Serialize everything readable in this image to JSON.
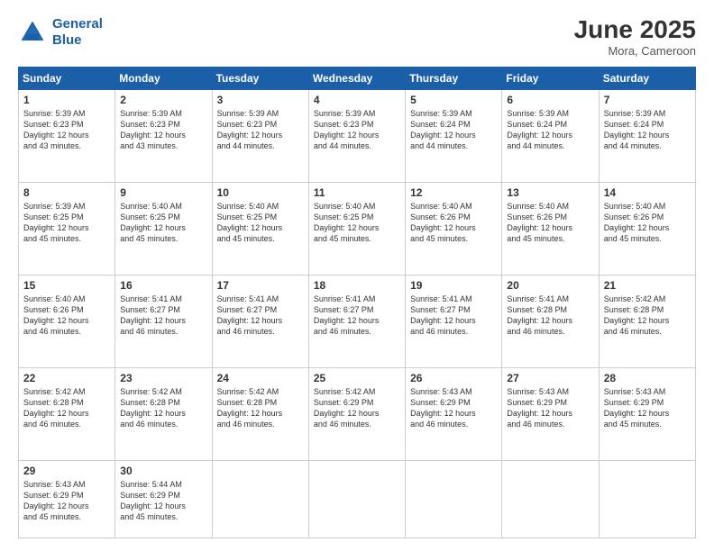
{
  "logo": {
    "line1": "General",
    "line2": "Blue"
  },
  "title": "June 2025",
  "location": "Mora, Cameroon",
  "headers": [
    "Sunday",
    "Monday",
    "Tuesday",
    "Wednesday",
    "Thursday",
    "Friday",
    "Saturday"
  ],
  "weeks": [
    [
      {
        "day": "1",
        "text": "Sunrise: 5:39 AM\nSunset: 6:23 PM\nDaylight: 12 hours\nand 43 minutes."
      },
      {
        "day": "2",
        "text": "Sunrise: 5:39 AM\nSunset: 6:23 PM\nDaylight: 12 hours\nand 43 minutes."
      },
      {
        "day": "3",
        "text": "Sunrise: 5:39 AM\nSunset: 6:23 PM\nDaylight: 12 hours\nand 44 minutes."
      },
      {
        "day": "4",
        "text": "Sunrise: 5:39 AM\nSunset: 6:23 PM\nDaylight: 12 hours\nand 44 minutes."
      },
      {
        "day": "5",
        "text": "Sunrise: 5:39 AM\nSunset: 6:24 PM\nDaylight: 12 hours\nand 44 minutes."
      },
      {
        "day": "6",
        "text": "Sunrise: 5:39 AM\nSunset: 6:24 PM\nDaylight: 12 hours\nand 44 minutes."
      },
      {
        "day": "7",
        "text": "Sunrise: 5:39 AM\nSunset: 6:24 PM\nDaylight: 12 hours\nand 44 minutes."
      }
    ],
    [
      {
        "day": "8",
        "text": "Sunrise: 5:39 AM\nSunset: 6:25 PM\nDaylight: 12 hours\nand 45 minutes."
      },
      {
        "day": "9",
        "text": "Sunrise: 5:40 AM\nSunset: 6:25 PM\nDaylight: 12 hours\nand 45 minutes."
      },
      {
        "day": "10",
        "text": "Sunrise: 5:40 AM\nSunset: 6:25 PM\nDaylight: 12 hours\nand 45 minutes."
      },
      {
        "day": "11",
        "text": "Sunrise: 5:40 AM\nSunset: 6:25 PM\nDaylight: 12 hours\nand 45 minutes."
      },
      {
        "day": "12",
        "text": "Sunrise: 5:40 AM\nSunset: 6:26 PM\nDaylight: 12 hours\nand 45 minutes."
      },
      {
        "day": "13",
        "text": "Sunrise: 5:40 AM\nSunset: 6:26 PM\nDaylight: 12 hours\nand 45 minutes."
      },
      {
        "day": "14",
        "text": "Sunrise: 5:40 AM\nSunset: 6:26 PM\nDaylight: 12 hours\nand 45 minutes."
      }
    ],
    [
      {
        "day": "15",
        "text": "Sunrise: 5:40 AM\nSunset: 6:26 PM\nDaylight: 12 hours\nand 46 minutes."
      },
      {
        "day": "16",
        "text": "Sunrise: 5:41 AM\nSunset: 6:27 PM\nDaylight: 12 hours\nand 46 minutes."
      },
      {
        "day": "17",
        "text": "Sunrise: 5:41 AM\nSunset: 6:27 PM\nDaylight: 12 hours\nand 46 minutes."
      },
      {
        "day": "18",
        "text": "Sunrise: 5:41 AM\nSunset: 6:27 PM\nDaylight: 12 hours\nand 46 minutes."
      },
      {
        "day": "19",
        "text": "Sunrise: 5:41 AM\nSunset: 6:27 PM\nDaylight: 12 hours\nand 46 minutes."
      },
      {
        "day": "20",
        "text": "Sunrise: 5:41 AM\nSunset: 6:28 PM\nDaylight: 12 hours\nand 46 minutes."
      },
      {
        "day": "21",
        "text": "Sunrise: 5:42 AM\nSunset: 6:28 PM\nDaylight: 12 hours\nand 46 minutes."
      }
    ],
    [
      {
        "day": "22",
        "text": "Sunrise: 5:42 AM\nSunset: 6:28 PM\nDaylight: 12 hours\nand 46 minutes."
      },
      {
        "day": "23",
        "text": "Sunrise: 5:42 AM\nSunset: 6:28 PM\nDaylight: 12 hours\nand 46 minutes."
      },
      {
        "day": "24",
        "text": "Sunrise: 5:42 AM\nSunset: 6:28 PM\nDaylight: 12 hours\nand 46 minutes."
      },
      {
        "day": "25",
        "text": "Sunrise: 5:42 AM\nSunset: 6:29 PM\nDaylight: 12 hours\nand 46 minutes."
      },
      {
        "day": "26",
        "text": "Sunrise: 5:43 AM\nSunset: 6:29 PM\nDaylight: 12 hours\nand 46 minutes."
      },
      {
        "day": "27",
        "text": "Sunrise: 5:43 AM\nSunset: 6:29 PM\nDaylight: 12 hours\nand 46 minutes."
      },
      {
        "day": "28",
        "text": "Sunrise: 5:43 AM\nSunset: 6:29 PM\nDaylight: 12 hours\nand 45 minutes."
      }
    ],
    [
      {
        "day": "29",
        "text": "Sunrise: 5:43 AM\nSunset: 6:29 PM\nDaylight: 12 hours\nand 45 minutes."
      },
      {
        "day": "30",
        "text": "Sunrise: 5:44 AM\nSunset: 6:29 PM\nDaylight: 12 hours\nand 45 minutes."
      },
      {
        "day": "",
        "text": ""
      },
      {
        "day": "",
        "text": ""
      },
      {
        "day": "",
        "text": ""
      },
      {
        "day": "",
        "text": ""
      },
      {
        "day": "",
        "text": ""
      }
    ]
  ]
}
